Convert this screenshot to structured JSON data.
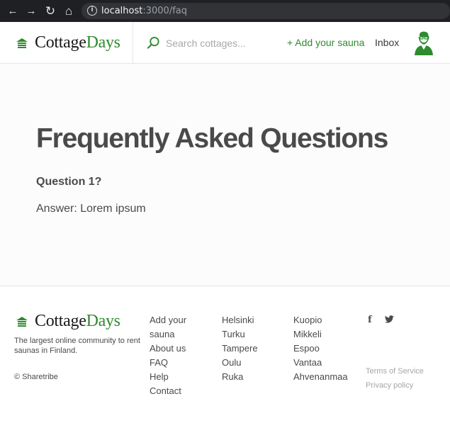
{
  "browser": {
    "url_host": "localhost",
    "url_path": ":3000/faq",
    "back_glyph": "←",
    "forward_glyph": "→",
    "reload_glyph": "↻",
    "home_glyph": "⌂",
    "info_glyph": "i"
  },
  "header": {
    "logo_text_1": "Cottage",
    "logo_text_2": "Days",
    "search_placeholder": "Search cottages...",
    "add_sauna_label": "+ Add your sauna",
    "inbox_label": "Inbox"
  },
  "main": {
    "title": "Frequently Asked Questions",
    "question": "Question 1?",
    "answer": "Answer: Lorem ipsum"
  },
  "footer": {
    "logo_text_1": "Cottage",
    "logo_text_2": "Days",
    "description": "The largest online community to rent saunas in Finland.",
    "copyright": "© Sharetribe",
    "col1": [
      "Add your sauna",
      "About us",
      "FAQ",
      "Help",
      "Contact"
    ],
    "col2": [
      "Helsinki",
      "Turku",
      "Tampere",
      "Oulu",
      "Ruka"
    ],
    "col3": [
      "Kuopio",
      "Mikkeli",
      "Espoo",
      "Vantaa",
      "Ahvenanmaa"
    ],
    "facebook_glyph": "f",
    "twitter_glyph": "🐦",
    "terms": "Terms of Service",
    "privacy": "Privacy policy"
  },
  "colors": {
    "brand_green": "#2e8b2e",
    "text": "#4a4a4a",
    "browser_bar": "#1f2023"
  }
}
